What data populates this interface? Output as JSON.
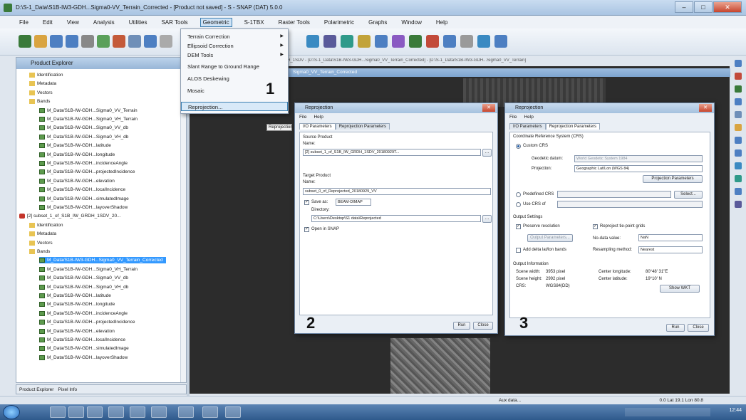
{
  "window": {
    "title": "D:\\S-1_Data\\S1B-IW3-GDH...Sigma0-VV_Terrain_Corrected - [Product not saved] - S - SNAP (DAT) 5.0.0"
  },
  "menubar": [
    "File",
    "Edit",
    "View",
    "Analysis",
    "Utilities",
    "SAR Tools",
    "Geometric",
    "S-1TBX",
    "Raster Tools",
    "Polarimetric",
    "Graphs",
    "Window",
    "Help"
  ],
  "dropdown": {
    "items": [
      {
        "label": "Terrain Correction",
        "has_submenu": true
      },
      {
        "label": "Ellipsoid Correction",
        "has_submenu": true
      },
      {
        "label": "DEM Tools",
        "has_submenu": true
      },
      {
        "label": "Slant Range to Ground Range",
        "has_submenu": false
      },
      {
        "label": "ALOS Deskewing",
        "has_submenu": false
      },
      {
        "label": "Mosaic",
        "has_submenu": false
      },
      {
        "label": "Reprojection...",
        "has_submenu": false
      }
    ]
  },
  "steps": [
    "1",
    "2",
    "3"
  ],
  "explorer": {
    "header": "Product Explorer",
    "tabs": [
      "Product Explorer",
      "Pixel Info"
    ],
    "items": [
      {
        "label": "Identification",
        "icon": "folder",
        "indent": 1
      },
      {
        "label": "Metadata",
        "icon": "folder",
        "indent": 1
      },
      {
        "label": "Vectors",
        "icon": "folder",
        "indent": 1
      },
      {
        "label": "Bands",
        "icon": "folder",
        "indent": 1
      },
      {
        "label": "M_Data/S1B-IW-GDH...Sigma0_VV_Terrain",
        "icon": "band",
        "indent": 2
      },
      {
        "label": "M_Data/S1B-IW-GDH...Sigma0_VH_Terrain",
        "icon": "band",
        "indent": 2
      },
      {
        "label": "M_Data/S1B-IW-GDH...Sigma0_VV_db",
        "icon": "band",
        "indent": 2
      },
      {
        "label": "M_Data/S1B-IW-GDH...Sigma0_VH_db",
        "icon": "band",
        "indent": 2
      },
      {
        "label": "M_Data/S1B-IW-GDH...latitude",
        "icon": "band",
        "indent": 2
      },
      {
        "label": "M_Data/S1B-IW-GDH...longitude",
        "icon": "band",
        "indent": 2
      },
      {
        "label": "M_Data/S1B-IW-GDH...incidenceAngle",
        "icon": "band",
        "indent": 2
      },
      {
        "label": "M_Data/S1B-IW-GDH...projectedIncidence",
        "icon": "band",
        "indent": 2
      },
      {
        "label": "M_Data/S1B-IW-GDH...elevation",
        "icon": "band",
        "indent": 2
      },
      {
        "label": "M_Data/S1B-IW-GDH...localIncidence",
        "icon": "band",
        "indent": 2
      },
      {
        "label": "M_Data/S1B-IW-GDH...simulatedImage",
        "icon": "band",
        "indent": 2
      },
      {
        "label": "M_Data/S1B-IW-GDH...layoverShadow",
        "icon": "band",
        "indent": 2
      },
      {
        "label": "[2] subset_1_of_S1B_IW_GRDH_1SDV_20...",
        "icon": "product",
        "indent": 0
      },
      {
        "label": "Identification",
        "icon": "folder",
        "indent": 1
      },
      {
        "label": "Metadata",
        "icon": "folder",
        "indent": 1
      },
      {
        "label": "Vectors",
        "icon": "folder",
        "indent": 1
      },
      {
        "label": "Bands",
        "icon": "folder",
        "indent": 1
      },
      {
        "label": "M_Data/S1B-IW3-GDH...Sigma0_VV_Terrain_Corrected",
        "icon": "band",
        "indent": 2,
        "selected": true
      },
      {
        "label": "M_Data/S1B-IW-GDH...Sigma0_VH_Terrain",
        "icon": "band",
        "indent": 2
      },
      {
        "label": "M_Data/S1B-IW-GDH...Sigma0_VV_db",
        "icon": "band",
        "indent": 2
      },
      {
        "label": "M_Data/S1B-IW-GDH...Sigma0_VH_db",
        "icon": "band",
        "indent": 2
      },
      {
        "label": "M_Data/S1B-IW-GDH...latitude",
        "icon": "band",
        "indent": 2
      },
      {
        "label": "M_Data/S1B-IW-GDH...longitude",
        "icon": "band",
        "indent": 2
      },
      {
        "label": "M_Data/S1B-IW-GDH...incidenceAngle",
        "icon": "band",
        "indent": 2
      },
      {
        "label": "M_Data/S1B-IW-GDH...projectedIncidence",
        "icon": "band",
        "indent": 2
      },
      {
        "label": "M_Data/S1B-IW-GDH...elevation",
        "icon": "band",
        "indent": 2
      },
      {
        "label": "M_Data/S1B-IW-GDH...localIncidence",
        "icon": "band",
        "indent": 2
      },
      {
        "label": "M_Data/S1B-IW-GDH...simulatedImage",
        "icon": "band",
        "indent": 2
      },
      {
        "label": "M_Data/S1B-IW-GDH...layoverShadow",
        "icon": "band",
        "indent": 2
      }
    ]
  },
  "image_view": {
    "tab_label": "Sigma0_VV_Terrain_Corrected",
    "path": "[2] subset_1_of_S1B_IW_GRDH_1SDV - [D:\\S-1_Data\\S1B-IW3-GDH...Sigma0_VV_Terrain_Corrected] - [D:\\S-1_Data\\S1B-IW3-GDH...Sigma0_VV_Terrain]",
    "tooltip": "Reprojection"
  },
  "dialog1": {
    "title": "Reprojection",
    "menu": [
      "File",
      "Help"
    ],
    "tabs": [
      "I/O Parameters",
      "Reprojection Parameters"
    ],
    "source_section": "Source Product",
    "name_label": "Name:",
    "source_value": "[2] subset_1_of_S1B_IW_GRDH_1SDV_20180929T...",
    "target_section": "Target Product",
    "target_name_label": "Name:",
    "target_value": "subset_0_of_Reprojected_20180929_VV",
    "save_as_label": "Save as:",
    "save_as_format": "BEAM-DIMAP",
    "directory_label": "Directory:",
    "directory_value": "C:\\Users\\Desktop\\S1 data\\Reprojected",
    "open_in_snap": "Open in SNAP",
    "run": "Run",
    "close": "Close"
  },
  "dialog2": {
    "title": "Reprojection",
    "menu": [
      "File",
      "Help"
    ],
    "tabs": [
      "I/O Parameters",
      "Reprojection Parameters"
    ],
    "crs_section": "Coordinate Reference System (CRS)",
    "custom_crs": "Custom CRS",
    "geodetic_label": "Geodetic datum:",
    "geodetic_value": "World Geodetic System 1984",
    "projection_label": "Projection:",
    "projection_value": "Geographic Lat/Lon (WGS 84)",
    "projection_params": "Projection Parameters",
    "predefined_crs": "Predefined CRS",
    "predefined_select": "Select...",
    "use_crs_of": "Use CRS of",
    "output_settings": "Output Settings",
    "preserve_resolution": "Preserve resolution",
    "reproject_tie_points": "Reproject tie-point grids",
    "output_params": "Output Parameters...",
    "nodata_label": "No-data value:",
    "nodata_value": "NaN",
    "add_delta": "Add delta lat/lon bands",
    "resampling_label": "Resampling method:",
    "resampling_value": "Nearest",
    "output_info": "Output Information",
    "scene_width_label": "Scene width:",
    "scene_width_value": "3953 pixel",
    "scene_height_label": "Scene height:",
    "scene_height_value": "2992 pixel",
    "crs_label": "CRS:",
    "crs_value": "WGS84(DD)",
    "center_lon_label": "Center longitude:",
    "center_lon_value": "80°48' 31\"E",
    "center_lat_label": "Center latitude:",
    "center_lat_value": "19°10' N",
    "show_wkt": "Show WKT",
    "run": "Run",
    "close": "Close"
  },
  "status": {
    "left": "",
    "mid": "Aux data...",
    "right": "0.0 Lat 19.1 Lon 80.8"
  },
  "taskbar": {
    "clock": "12:44"
  },
  "colors": {
    "selection": "#3399ff",
    "menu_highlight": "#d8e9f8",
    "title_bar": "#a9c4e2"
  }
}
